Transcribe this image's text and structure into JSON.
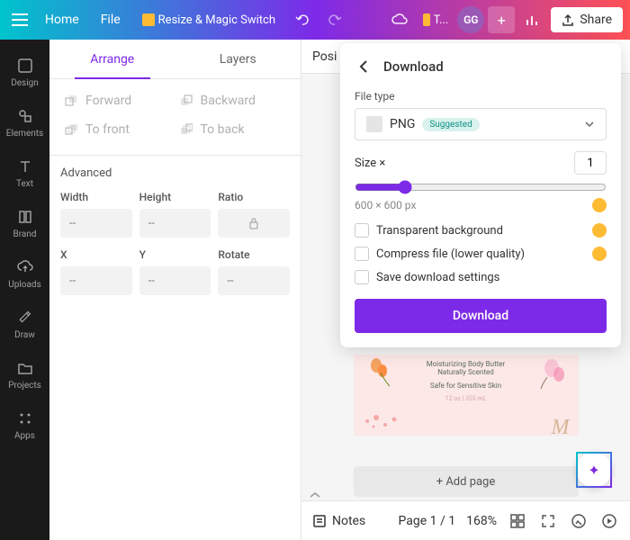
{
  "topbar": {
    "home": "Home",
    "file": "File",
    "resize": "Resize & Magic Switch",
    "try_pro": "T...",
    "avatar": "GG",
    "share": "Share"
  },
  "sidebar": {
    "items": [
      {
        "label": "Design"
      },
      {
        "label": "Elements"
      },
      {
        "label": "Text"
      },
      {
        "label": "Brand"
      },
      {
        "label": "Uploads"
      },
      {
        "label": "Draw"
      },
      {
        "label": "Projects"
      },
      {
        "label": "Apps"
      }
    ]
  },
  "left_panel": {
    "tabs": {
      "arrange": "Arrange",
      "layers": "Layers"
    },
    "forward": "Forward",
    "backward": "Backward",
    "to_front": "To front",
    "to_back": "To back",
    "advanced": "Advanced",
    "fields": {
      "width": "Width",
      "height": "Height",
      "ratio": "Ratio",
      "x": "X",
      "y": "Y",
      "rotate": "Rotate",
      "placeholder": "--"
    }
  },
  "pos_bar": {
    "position": "Posi"
  },
  "download": {
    "title": "Download",
    "file_type": "File type",
    "format": "PNG",
    "suggested": "Suggested",
    "size_label": "Size ×",
    "size_value": "1",
    "dims": "600 × 600 px",
    "transparent": "Transparent background",
    "compress": "Compress file (lower quality)",
    "save_settings": "Save download settings",
    "button": "Download"
  },
  "canvas": {
    "card": {
      "line1": "Moisturizing Body Butter",
      "line2": "Naturally Scented",
      "line3": "Safe for Sensitive Skin",
      "size": "12 oz | 355 mL"
    },
    "add_page": "+ Add page"
  },
  "bottombar": {
    "notes": "Notes",
    "page": "Page 1 / 1",
    "zoom": "168%"
  }
}
